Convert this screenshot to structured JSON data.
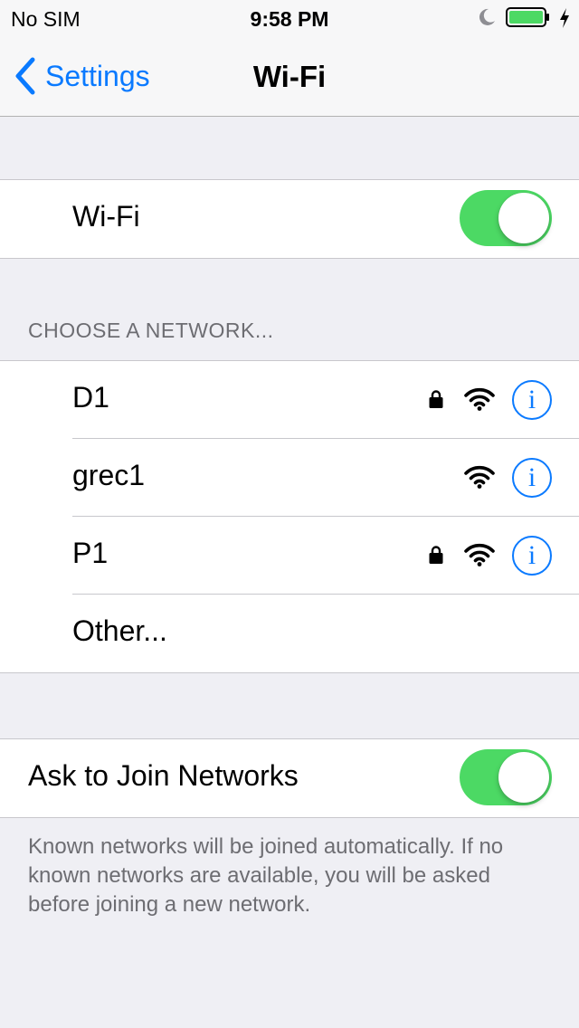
{
  "status_bar": {
    "carrier": "No SIM",
    "time": "9:58 PM",
    "icons": [
      "moon-icon",
      "battery-icon",
      "charging-bolt-icon"
    ],
    "battery_color": "#4cd964"
  },
  "nav": {
    "back_label": "Settings",
    "title": "Wi-Fi"
  },
  "wifi_toggle": {
    "label": "Wi-Fi",
    "on": true
  },
  "networks": {
    "header": "CHOOSE A NETWORK...",
    "items": [
      {
        "name": "D1",
        "secured": true
      },
      {
        "name": "grec1",
        "secured": false
      },
      {
        "name": "P1",
        "secured": true
      }
    ],
    "other_label": "Other..."
  },
  "ask_to_join": {
    "label": "Ask to Join Networks",
    "on": true,
    "footer": "Known networks will be joined automatically. If no known networks are available, you will be asked before joining a new network."
  },
  "colors": {
    "accent": "#0a7aff",
    "toggle_on": "#4cd964",
    "background": "#efeff4",
    "secondary_text": "#6d6d72"
  }
}
